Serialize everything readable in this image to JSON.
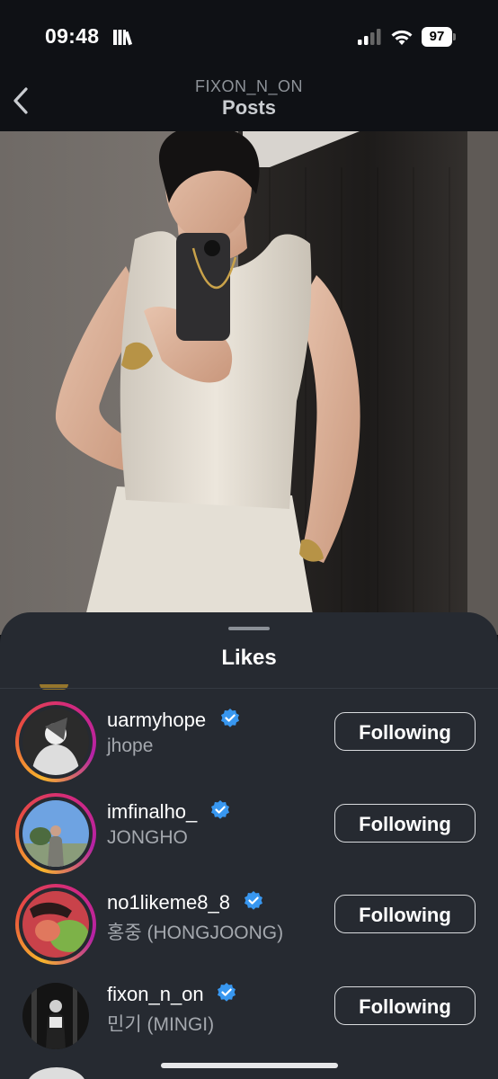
{
  "status_bar": {
    "time": "09:48",
    "battery": "97",
    "icons": [
      "books-icon",
      "signal-icon",
      "wifi-icon",
      "battery-icon"
    ]
  },
  "header": {
    "username": "FIXON_N_ON",
    "title": "Posts",
    "back_icon": "chevron-left-icon"
  },
  "sheet": {
    "title": "Likes",
    "rows": [
      {
        "username": "uarmyhope",
        "fullname": "jhope",
        "verified": true,
        "button": "Following"
      },
      {
        "username": "imfinalho_",
        "fullname": "JONGHO",
        "verified": true,
        "button": "Following"
      },
      {
        "username": "no1likeme8_8",
        "fullname": "홍중 (HONGJOONG)",
        "verified": true,
        "button": "Following"
      },
      {
        "username": "fixon_n_on",
        "fullname": "민기 (MINGI)",
        "verified": true,
        "button": "Following"
      }
    ]
  },
  "colors": {
    "background": "#0f1115",
    "sheet": "#262a31",
    "verified": "#3897f0",
    "text_secondary": "#a4a8ae"
  }
}
